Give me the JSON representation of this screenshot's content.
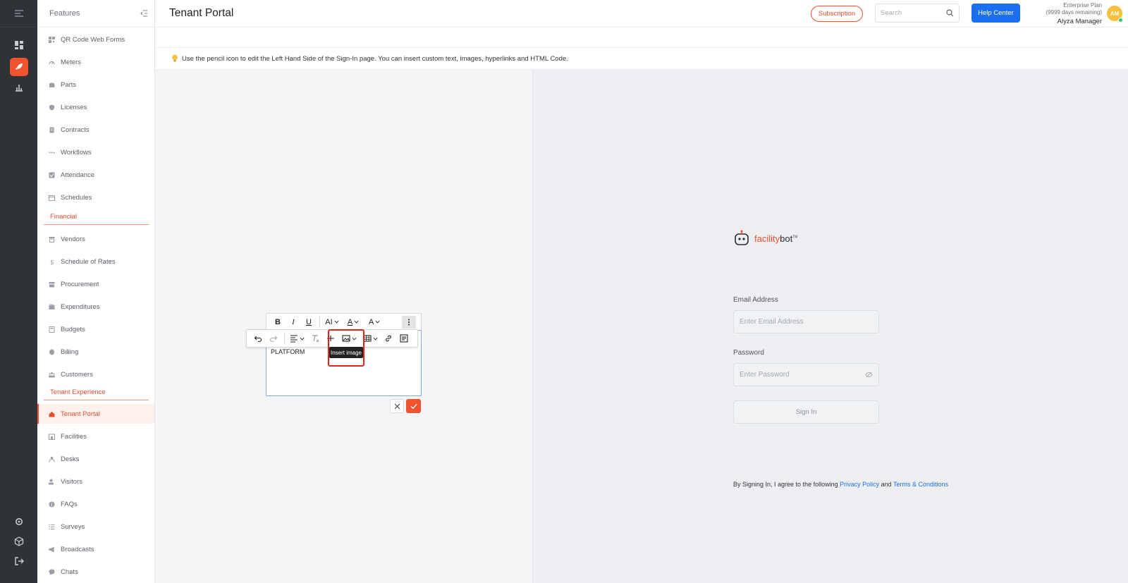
{
  "sidebar": {
    "title": "Features",
    "items": [
      {
        "label": "QR Code Web Forms",
        "icon": "qr-icon"
      },
      {
        "label": "Meters",
        "icon": "gauge-icon"
      },
      {
        "label": "Parts",
        "icon": "puzzle-icon"
      },
      {
        "label": "Licenses",
        "icon": "shield-icon"
      },
      {
        "label": "Contracts",
        "icon": "document-icon"
      },
      {
        "label": "Workflows",
        "icon": "dots-icon"
      },
      {
        "label": "Attendance",
        "icon": "check-icon"
      },
      {
        "label": "Schedules",
        "icon": "calendar-icon"
      },
      {
        "label": "Vendors",
        "icon": "store-icon"
      },
      {
        "label": "Schedule of Rates",
        "icon": "dollar-icon"
      },
      {
        "label": "Procurement",
        "icon": "cart-icon"
      },
      {
        "label": "Expenditures",
        "icon": "wallet-icon"
      },
      {
        "label": "Budgets",
        "icon": "calculator-icon"
      },
      {
        "label": "Billing",
        "icon": "coin-icon"
      },
      {
        "label": "Customers",
        "icon": "people-icon"
      },
      {
        "label": "Tenant Portal",
        "icon": "home-icon"
      },
      {
        "label": "Facilities",
        "icon": "building-icon"
      },
      {
        "label": "Desks",
        "icon": "desk-icon"
      },
      {
        "label": "Visitors",
        "icon": "visitor-icon"
      },
      {
        "label": "FAQs",
        "icon": "info-icon"
      },
      {
        "label": "Surveys",
        "icon": "list-icon"
      },
      {
        "label": "Broadcasts",
        "icon": "megaphone-icon"
      },
      {
        "label": "Chats",
        "icon": "chat-icon"
      }
    ],
    "sections": {
      "financial": "Financial",
      "tenant_experience": "Tenant Experience"
    }
  },
  "header": {
    "title": "Tenant Portal",
    "subscription_label": "Subscription",
    "search_placeholder": "Search",
    "help_label": "Help Center",
    "plan_name": "Enterprise Plan",
    "plan_remaining": "(9999 days remaining)",
    "user_name": "Alyza Manager",
    "avatar_initials": "AM"
  },
  "info_text": "Use the pencil icon to edit the Left Hand Side of the Sign-In page. You can insert custom text, images, hyperlinks and HTML Code.",
  "editor": {
    "content": "PLATFORM",
    "tooltip": "Insert image",
    "toolbar_row1": [
      "B",
      "I",
      "U",
      "AI",
      "A",
      "A"
    ],
    "accent": "#f0532d",
    "highlight_color": "#e2231a"
  },
  "signin": {
    "brand_part1": "facility",
    "brand_part2": "bot",
    "brand_tm": "TM",
    "email_label": "Email Address",
    "email_placeholder": "Enter Email Address",
    "password_label": "Password",
    "password_placeholder": "Enter Password",
    "signin_label": "Sign In",
    "agree_text": "By Signing In, I agree to the following",
    "privacy_link": "Privacy Policy",
    "and_text": "and",
    "terms_link": "Terms & Conditions"
  },
  "colors": {
    "brand": "#f0532d",
    "primary_blue": "#1d6ff2",
    "rail_bg": "#2f3237"
  }
}
